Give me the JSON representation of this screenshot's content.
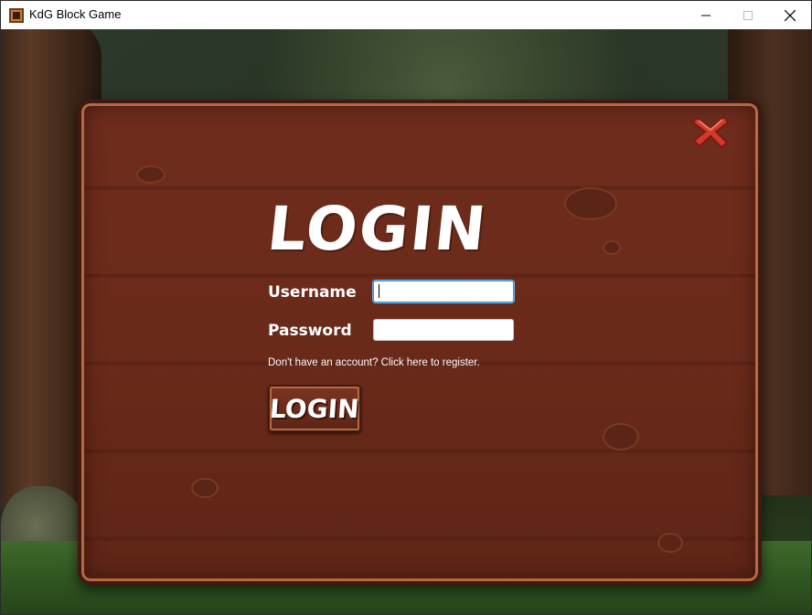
{
  "window": {
    "title": "KdG Block Game",
    "controls": [
      "minimize",
      "maximize",
      "close"
    ]
  },
  "login_form": {
    "heading": "LOGIN",
    "username_label": "Username",
    "username_value": "",
    "password_label": "Password",
    "password_value": "",
    "register_text": "Don't have an account? Click here to register.",
    "login_button": "LOGIN"
  },
  "icons": {
    "app": "app-icon",
    "close_sign": "close-x-icon"
  },
  "colors": {
    "wood": "#6a2a1a",
    "wood_edge": "#b8693f",
    "close_red": "#d23a2a",
    "focus_border": "#2f8fd6"
  }
}
